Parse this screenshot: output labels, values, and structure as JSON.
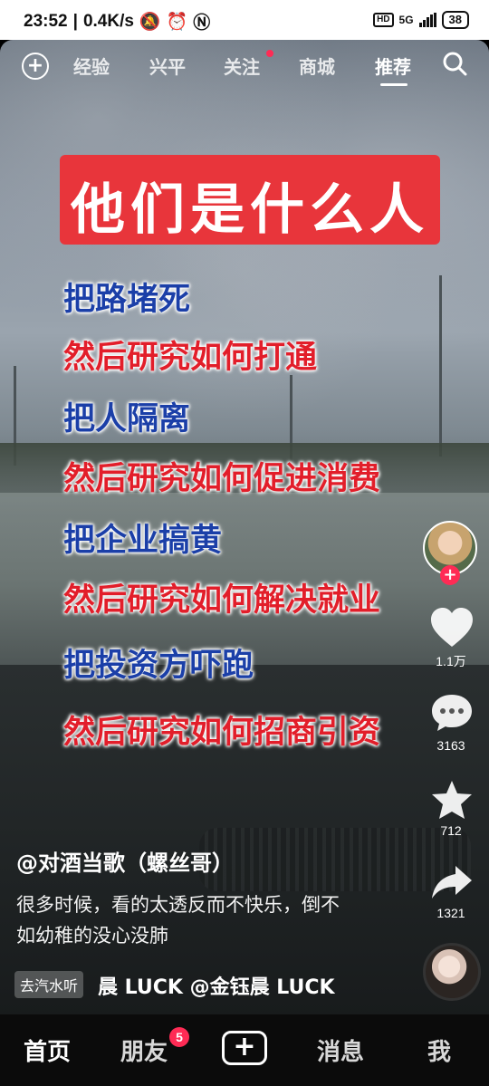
{
  "status_bar": {
    "time": "23:52",
    "speed": "0.4K/s",
    "hd": "HD",
    "network": "5G",
    "battery": "38"
  },
  "top_tabs": [
    {
      "label": "经验"
    },
    {
      "label": "兴平"
    },
    {
      "label": "关注"
    },
    {
      "label": "商城"
    },
    {
      "label": "推荐",
      "active": true
    }
  ],
  "overlay": {
    "title": "他们是什么人",
    "lines": [
      {
        "text": "把路堵死",
        "color": "blue"
      },
      {
        "text": "然后研究如何打通",
        "color": "red"
      },
      {
        "text": "把人隔离",
        "color": "blue"
      },
      {
        "text": "然后研究如何促进消费",
        "color": "red"
      },
      {
        "text": "把企业搞黄",
        "color": "blue"
      },
      {
        "text": "然后研究如何解决就业",
        "color": "red"
      },
      {
        "text": "把投资方吓跑",
        "color": "blue"
      },
      {
        "text": "然后研究如何招商引资",
        "color": "red"
      }
    ]
  },
  "actions": {
    "likes": "1.1万",
    "comments": "3163",
    "favorites": "712",
    "shares": "1321"
  },
  "caption": {
    "author": "@对酒当歌（螺丝哥）",
    "text": "很多时候，看的太透反而不快乐，倒不如幼稚的没心没肺",
    "music_tag": "去汽水听",
    "music": "晨 LUCK    @金钰晨 LUCK"
  },
  "bottom_nav": {
    "home": "首页",
    "friends": "朋友",
    "friends_badge": "5",
    "create": "+",
    "messages": "消息",
    "me": "我"
  },
  "colors": {
    "accent": "#ff2b55",
    "title_bg": "#e8353b",
    "blue_text": "#1b3fa8",
    "red_text": "#e21e2a"
  }
}
